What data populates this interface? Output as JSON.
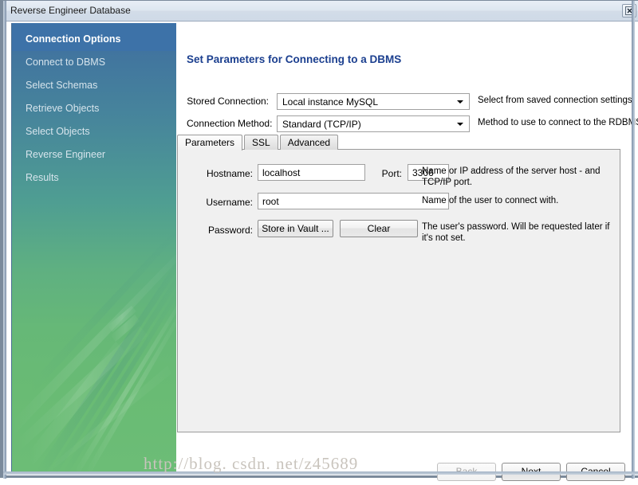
{
  "window": {
    "title": "Reverse Engineer Database",
    "close_icon": "close-icon",
    "close_label": "×"
  },
  "sidebar": {
    "items": [
      {
        "label": "Connection Options",
        "selected": true
      },
      {
        "label": "Connect to DBMS",
        "selected": false
      },
      {
        "label": "Select Schemas",
        "selected": false
      },
      {
        "label": "Retrieve Objects",
        "selected": false
      },
      {
        "label": "Select Objects",
        "selected": false
      },
      {
        "label": "Reverse Engineer",
        "selected": false
      },
      {
        "label": "Results",
        "selected": false
      }
    ],
    "colors": {
      "selected_bg": "#3d72a8",
      "gradient_top": "#3d72a8",
      "gradient_bottom": "#6cbd76"
    }
  },
  "main": {
    "page_title": "Set Parameters for Connecting to a DBMS",
    "title_color": "#1b3f8f",
    "stored_connection": {
      "label": "Stored Connection:",
      "value": "Local instance MySQL",
      "help": "Select from saved connection settings",
      "arrow_icon": "chevron-down-icon"
    },
    "connection_method": {
      "label": "Connection Method:",
      "value": "Standard (TCP/IP)",
      "help": "Method to use to connect to the RDBMS",
      "arrow_icon": "chevron-down-icon"
    },
    "tabs": [
      {
        "label": "Parameters",
        "active": true
      },
      {
        "label": "SSL",
        "active": false
      },
      {
        "label": "Advanced",
        "active": false
      }
    ],
    "parameters": {
      "hostname": {
        "label": "Hostname:",
        "value": "localhost",
        "placeholder": ""
      },
      "port": {
        "label": "Port:",
        "value": "3306",
        "placeholder": ""
      },
      "hostname_help": "Name or IP address of the server host - and TCP/IP port.",
      "username": {
        "label": "Username:",
        "value": "root",
        "placeholder": ""
      },
      "username_help": "Name of the user to connect with.",
      "password": {
        "label": "Password:",
        "store_button": "Store in Vault ...",
        "clear_button": "Clear"
      },
      "password_help": "The user's password. Will be requested later if it's not set."
    }
  },
  "footer": {
    "back": {
      "label": "Back",
      "disabled": true
    },
    "next": {
      "label": "Next",
      "disabled": false
    },
    "cancel": {
      "label": "Cancel",
      "disabled": false
    }
  },
  "watermark": {
    "text": "http://blog. csdn. net/z45689"
  }
}
